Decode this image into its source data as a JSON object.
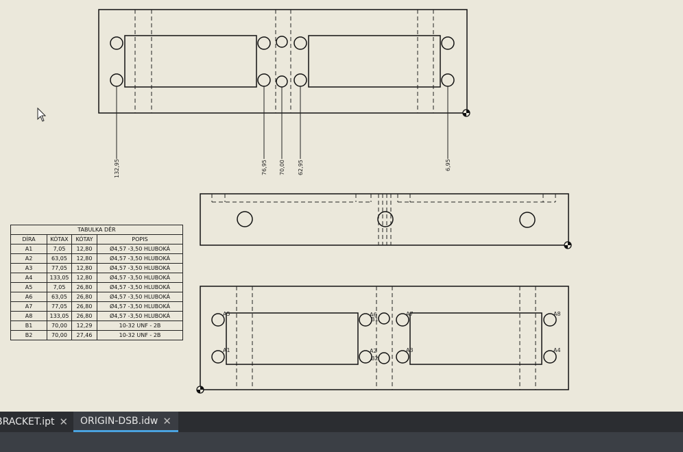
{
  "tabs": [
    {
      "label": "BRACKET.ipt",
      "close_icon": "close-icon",
      "active": false
    },
    {
      "label": "ORIGIN-DSB.idw",
      "close_icon": "close-icon",
      "active": true
    }
  ],
  "dimensions": [
    "132,95",
    "76,95",
    "70,00",
    "62,95",
    "6,95"
  ],
  "hole_tags": [
    "A6",
    "A7",
    "A8",
    "A1",
    "A2",
    "A3",
    "A4",
    "A5",
    "B1",
    "B2"
  ],
  "hole_table": {
    "title": "TABULKA DĚR",
    "headers": [
      "DÍRA",
      "KÓTAX",
      "KÓTAY",
      "POPIS"
    ],
    "rows": [
      [
        "A1",
        "7,05",
        "12,80",
        "Ø4,57 -3,50 HLUBOKÁ"
      ],
      [
        "A2",
        "63,05",
        "12,80",
        "Ø4,57 -3,50 HLUBOKÁ"
      ],
      [
        "A3",
        "77,05",
        "12,80",
        "Ø4,57 -3,50 HLUBOKÁ"
      ],
      [
        "A4",
        "133,05",
        "12,80",
        "Ø4,57 -3,50 HLUBOKÁ"
      ],
      [
        "A5",
        "7,05",
        "26,80",
        "Ø4,57 -3,50 HLUBOKÁ"
      ],
      [
        "A6",
        "63,05",
        "26,80",
        "Ø4,57 -3,50 HLUBOKÁ"
      ],
      [
        "A7",
        "77,05",
        "26,80",
        "Ø4,57 -3,50 HLUBOKÁ"
      ],
      [
        "A8",
        "133,05",
        "26,80",
        "Ø4,57 -3,50 HLUBOKÁ"
      ],
      [
        "B1",
        "70,00",
        "12,29",
        "10-32 UNF - 2B"
      ],
      [
        "B2",
        "70,00",
        "27,46",
        "10-32 UNF - 2B"
      ]
    ]
  },
  "colors": {
    "sheet": "#ebe8db",
    "tabbar": "#2b2d31",
    "active_tab_accent": "#4aa3e0",
    "statusbar": "#3b3f45"
  }
}
